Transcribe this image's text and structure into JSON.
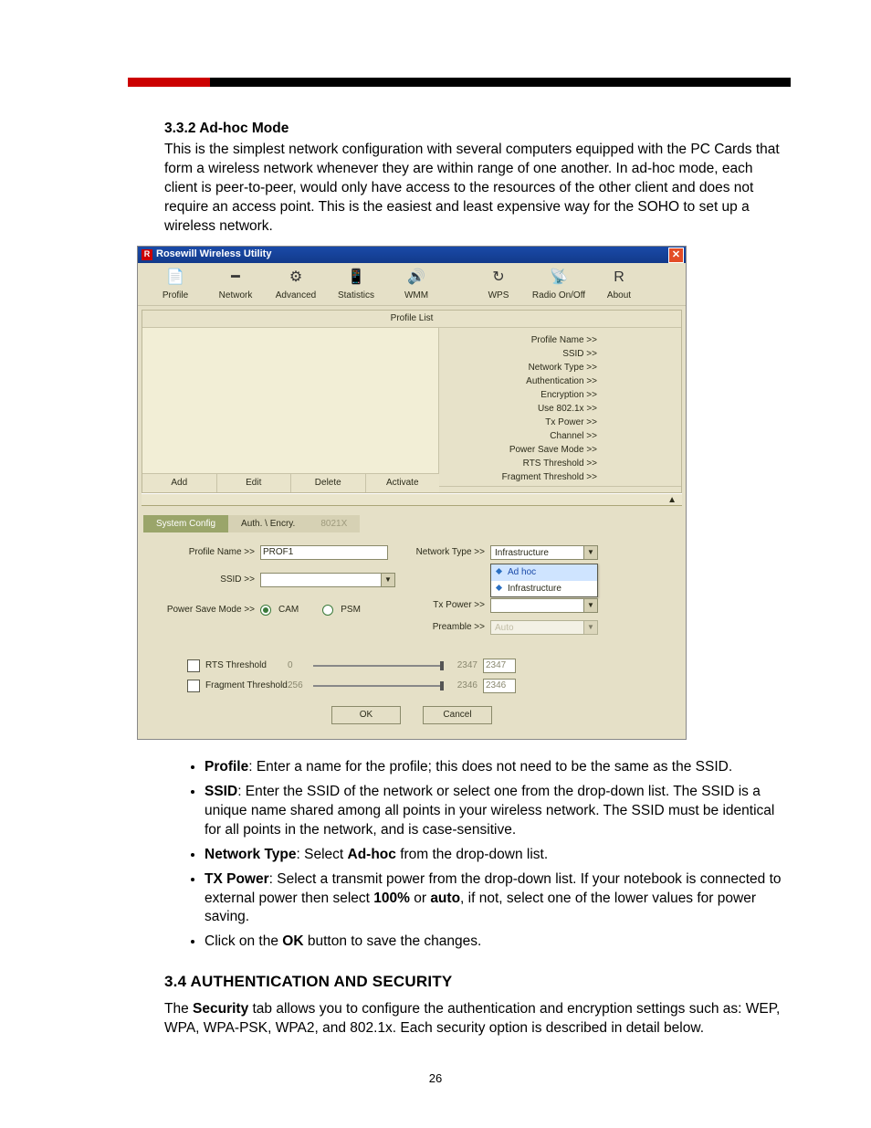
{
  "page_number": "26",
  "section_332": {
    "heading": "3.3.2  Ad-hoc Mode",
    "body": "This is the simplest network configuration with several computers equipped with the PC Cards that form a wireless network whenever they are within range of one another.  In ad-hoc mode, each client is peer-to-peer, would only have access to the resources of the other client and does not require an access point. This is the easiest and least expensive way for the SOHO to set up a wireless network."
  },
  "window": {
    "title": "Rosewill Wireless Utility",
    "toolbar": [
      {
        "label": "Profile",
        "glyph": "📄"
      },
      {
        "label": "Network",
        "glyph": "━"
      },
      {
        "label": "Advanced",
        "glyph": "⚙"
      },
      {
        "label": "Statistics",
        "glyph": "📱"
      },
      {
        "label": "WMM",
        "glyph": "🔊"
      },
      {
        "label": "WPS",
        "glyph": "↻"
      },
      {
        "label": "Radio On/Off",
        "glyph": "📡"
      },
      {
        "label": "About",
        "glyph": "R"
      }
    ],
    "profile_list_header": "Profile List",
    "info_rows": [
      "Profile Name >>",
      "SSID >>",
      "Network Type >>",
      "Authentication >>",
      "Encryption >>",
      "Use 802.1x >>",
      "Tx Power >>",
      "Channel >>",
      "Power Save Mode >>",
      "RTS Threshold >>",
      "Fragment Threshold >>"
    ],
    "actions": [
      "Add",
      "Edit",
      "Delete",
      "Activate"
    ],
    "tabs": {
      "system_config": "System Config",
      "auth_encry": "Auth. \\ Encry.",
      "dot1x": "8021X"
    },
    "form": {
      "profile_name_label": "Profile Name >>",
      "profile_name_value": "PROF1",
      "ssid_label": "SSID >>",
      "ssid_value": "",
      "network_type_label": "Network Type >>",
      "network_type_value": "Infrastructure",
      "dropdown_options": [
        "Ad hoc",
        "Infrastructure"
      ],
      "tx_power_label": "Tx Power >>",
      "tx_power_value": "",
      "preamble_label": "Preamble >>",
      "preamble_value": "Auto",
      "psm_label": "Power Save Mode >>",
      "psm_cam": "CAM",
      "psm_psm": "PSM",
      "rts_label": "RTS Threshold",
      "rts_min": "0",
      "rts_max": "2347",
      "rts_value": "2347",
      "frag_label": "Fragment Threshold",
      "frag_min": "256",
      "frag_max": "2346",
      "frag_value": "2346",
      "ok": "OK",
      "cancel": "Cancel"
    }
  },
  "bullets": {
    "profile_b": "Profile",
    "profile_t": ": Enter a name for the profile; this does not need to be the same as the SSID.",
    "ssid_b": "SSID",
    "ssid_t": ": Enter the SSID of the network or select one from the drop-down list. The SSID is a unique name shared among all points in your wireless network. The SSID must be identical for all points in the network, and is case-sensitive.",
    "nt_b": "Network Type",
    "nt_t1": ": Select ",
    "nt_b2": "Ad-hoc",
    "nt_t2": " from the drop-down list.",
    "tx_b": "TX Power",
    "tx_t1": ": Select a transmit power from the drop-down list. If your notebook is connected to external power then select ",
    "tx_b2": "100%",
    "tx_t2": " or ",
    "tx_b3": "auto",
    "tx_t3": ", if not, select one of the lower values for power saving.",
    "ok_t1": "Click on the ",
    "ok_b": "OK",
    "ok_t2": " button to save the changes."
  },
  "section_34": {
    "heading": "3.4  AUTHENTICATION AND SECURITY",
    "body_t1": "The ",
    "body_b": "Security",
    "body_t2": " tab allows you to configure the authentication and encryption settings such as: WEP, WPA, WPA-PSK, WPA2, and 802.1x. Each security option is described in detail below."
  }
}
